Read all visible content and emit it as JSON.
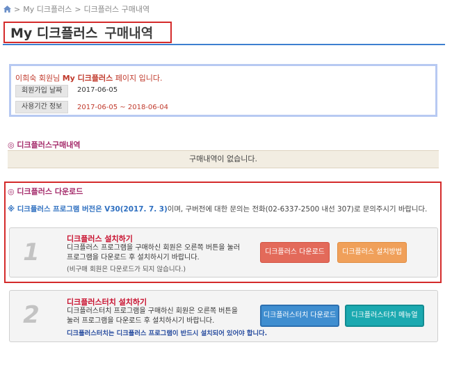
{
  "breadcrumb": {
    "items": [
      "My 디크플러스",
      "디크플러스 구매내역"
    ],
    "separator": ">"
  },
  "page_title": {
    "main": "My 디크플러스",
    "sub": "구매내역"
  },
  "member_info": {
    "greeting_name": "이희숙",
    "greeting_mid": " 회원님 ",
    "greeting_brand": "My 디크플러스",
    "greeting_end": " 페이지 입니다.",
    "join_date_label": "회원가입 날짜",
    "join_date_value": "2017-06-05",
    "period_label": "사용기간 정보",
    "period_value": "2017-06-05 ~ 2018-06-04"
  },
  "purchase_section": {
    "title": "◎ 디크플러스구매내역",
    "empty_text": "구매내역이 없습니다."
  },
  "download_section": {
    "title": "◎ 디크플러스 다운로드",
    "notice_bold": "※ 디크플러스 프로그램 버전은 V30(2017. 7. 3)",
    "notice_rest": "이며, 구버전에 대한 문의는 전화(02-6337-2500 내선 307)로 문의주시기 바랍니다.",
    "step1": {
      "number": "1",
      "title": "디크플러스 설치하기",
      "desc_line1": "디크플러스 프로그램을 구매하신 회원은 오른쪽 버튼을 눌러",
      "desc_line2": "프로그램을 다운로드 후 설치하시기 바랍니다.",
      "note": "(비구매 회원은 다운로드가 되지 않습니다.)",
      "download_label": "디크플러스 다운로드",
      "guide_label": "디크플러스 설치방법"
    },
    "step2": {
      "number": "2",
      "title": "디크플러스터치 설치하기",
      "desc_line1": "디크플러스터치 프로그램을 구매하신 회원은 오른쪽 버튼을",
      "desc_line2": "눌러 프로그램을 다운로드 후 설치하시기 바랍니다.",
      "note": "디크플러스터치는 디크플러스 프로그램이 반드시 설치되어 있어야 합니다.",
      "download_label": "디크플러스터치 다운로드",
      "manual_label": "디크플러스터치 메뉴얼"
    }
  },
  "colors": {
    "accent_blue": "#3d7fd0",
    "highlight_red": "#d42a2a",
    "title_magenta": "#a42a6a"
  }
}
